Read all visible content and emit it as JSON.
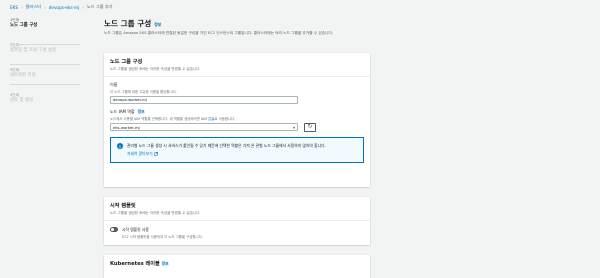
{
  "breadcrumb": {
    "items": [
      "EKS",
      "클러스터",
      "devops-eks-mj"
    ],
    "current": "노드 그룹 추가"
  },
  "steps": [
    {
      "num": "1단계",
      "title": "노드 그룹 구성"
    },
    {
      "num": "2단계",
      "title": "컴퓨팅 및 조정 구성 설정"
    },
    {
      "num": "3단계",
      "title": "네트워킹 지정"
    },
    {
      "num": "4단계",
      "title": "검토 및 생성"
    }
  ],
  "page": {
    "title": "노드 그룹 구성",
    "info": "정보",
    "description": "노드 그룹은 Amazon EKS 클러스터에 연결된 동일한 구성을 가진 EC2 인스턴스의 그룹입니다. 클러스터에는 여러 노드 그룹을 추가할 수 있습니다."
  },
  "node_group_config": {
    "title": "노드 그룹 구성",
    "subtitle": "노드 그룹을 생성한 후에는 이러한 속성을 변경할 수 없습니다.",
    "name_label": "이름",
    "name_desc": "이 노드 그룹에 대한 고유한 이름을 할당합니다.",
    "name_value": "devops-worker-mj",
    "iam_label": "노드 IAM 역할",
    "iam_info": "정보",
    "iam_desc_pre": "노드에서 사용할 IAM 역할을 선택합니다. 새 역할을 생성하려면 IAM ",
    "iam_desc_link": "콘솔",
    "iam_desc_post": "로 이동합니다.",
    "iam_value": "eks-worker-mj",
    "alert_text": "관리형 노드 그룹 생성 시 서비스가 롤인될 수 있기 때문에 선택한 역할은 가져 온 관형 노드 그룹에서 사용하지 않아야 합니다.",
    "alert_link": "자세히 알아보기"
  },
  "launch_template": {
    "title": "시작 템플릿",
    "subtitle": "노드 그룹을 생성한 후에는 이러한 속성을 변경할 수 없습니다.",
    "toggle_label": "시작 템플릿 사용",
    "toggle_desc": "EC2 시작 템플릿을 사용하여 이 노드 그룹을 구성합니다."
  },
  "kubernetes_labels": {
    "title": "Kubernetes 레이블",
    "info": "정보"
  }
}
